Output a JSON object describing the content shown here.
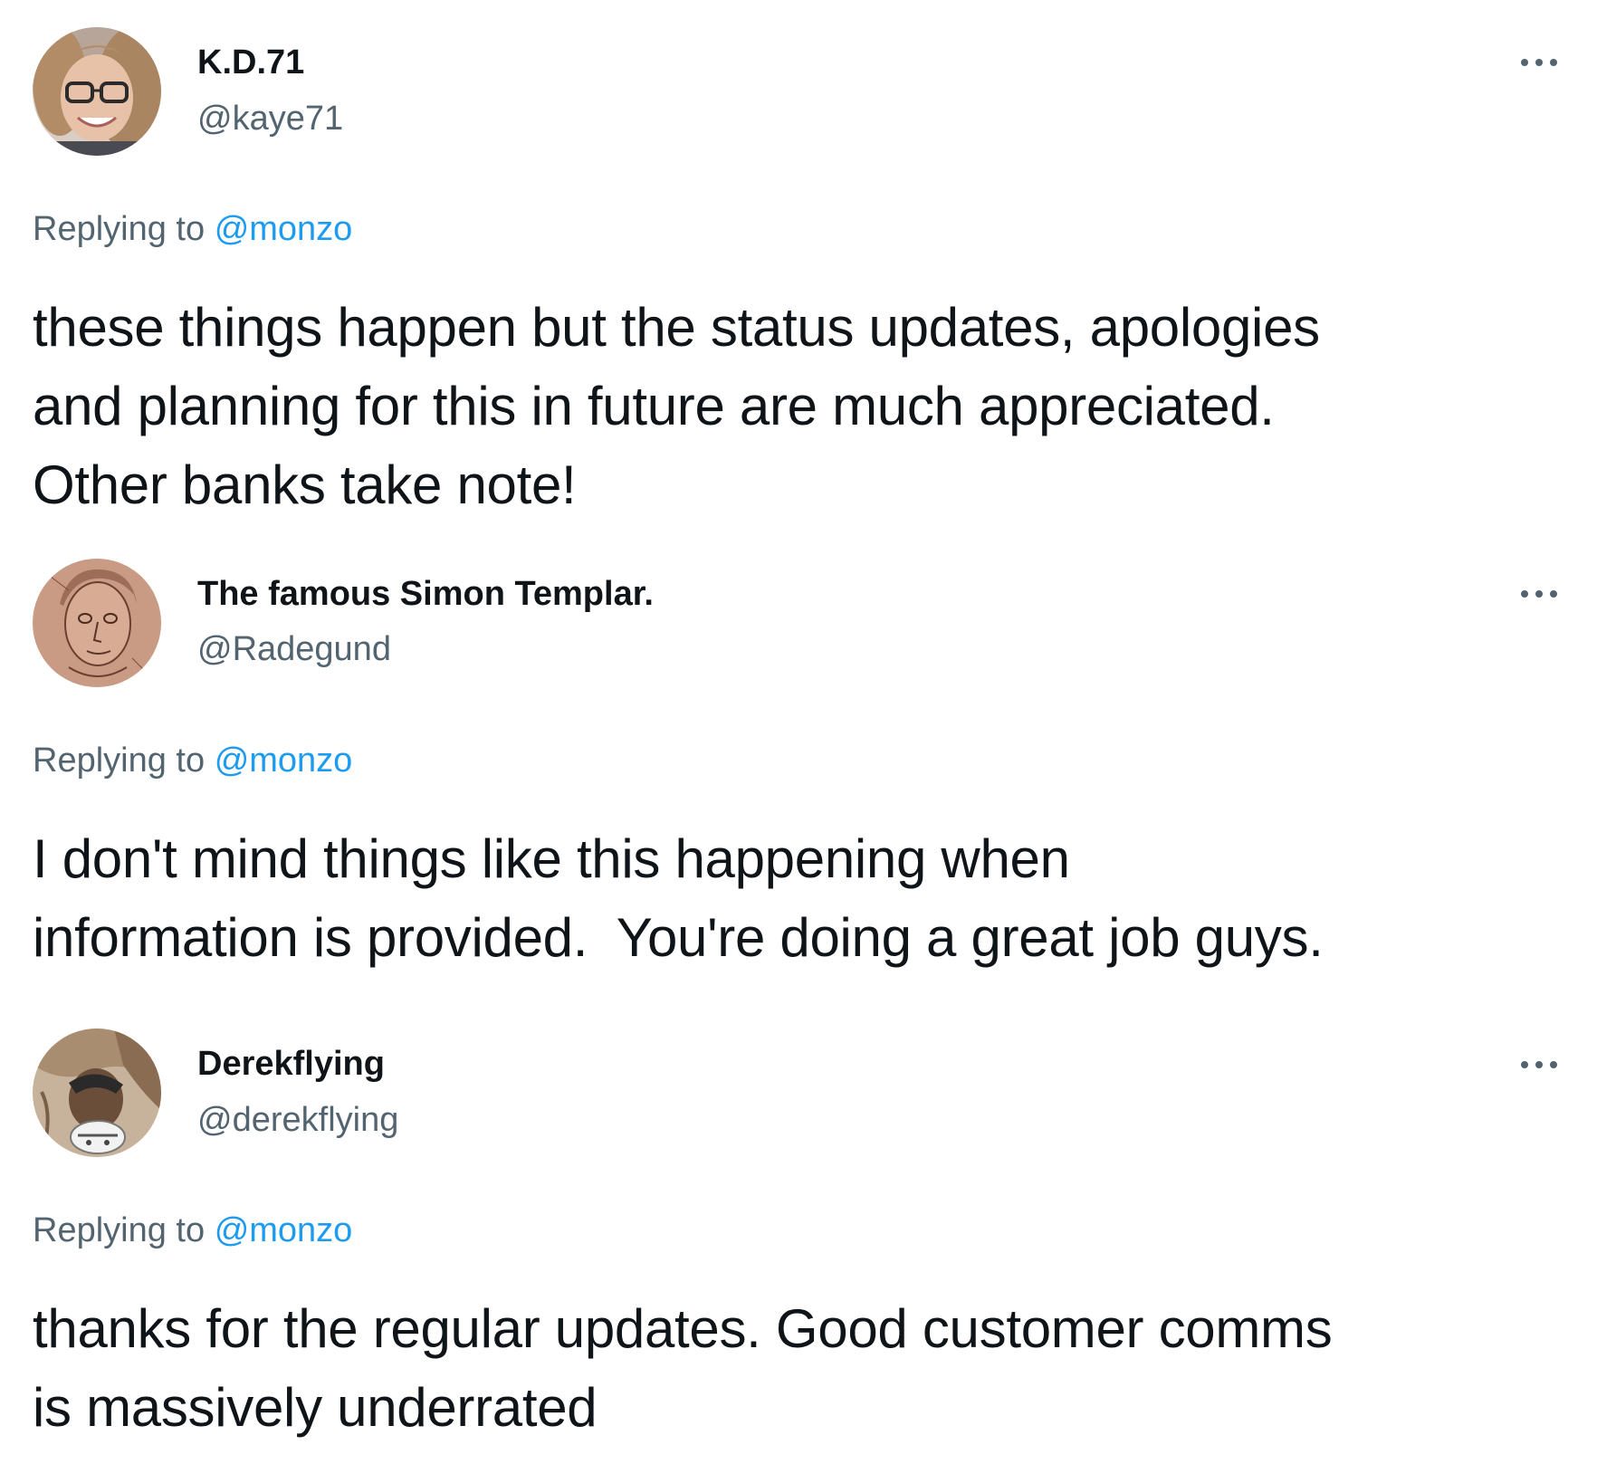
{
  "tweets": [
    {
      "display_name": "K.D.71",
      "handle": "@kaye71",
      "avatar_icon": "avatar-photo-woman-glasses",
      "more_icon": "more-horizontal-icon",
      "replying_prefix": "Replying to",
      "replying_to": "@monzo",
      "text": "these things happen but the status updates, apologies\nand planning for this in future are much appreciated.\nOther banks take note!"
    },
    {
      "display_name": "The famous Simon Templar.",
      "handle": "@Radegund",
      "avatar_icon": "avatar-sketch-portrait",
      "more_icon": "more-horizontal-icon",
      "replying_prefix": "Replying to",
      "replying_to": "@monzo",
      "text": "I don't mind things like this happening when\ninformation is provided.  You're doing a great job guys."
    },
    {
      "display_name": "Derekflying",
      "handle": "@derekflying",
      "avatar_icon": "avatar-photo-helmet",
      "more_icon": "more-horizontal-icon",
      "replying_prefix": "Replying to",
      "replying_to": "@monzo",
      "text": "thanks for the regular updates. Good customer comms\nis massively underrated"
    }
  ],
  "colors": {
    "text_primary": "#0f1419",
    "text_secondary": "#536471",
    "link": "#1d9bf0",
    "background": "#ffffff"
  }
}
